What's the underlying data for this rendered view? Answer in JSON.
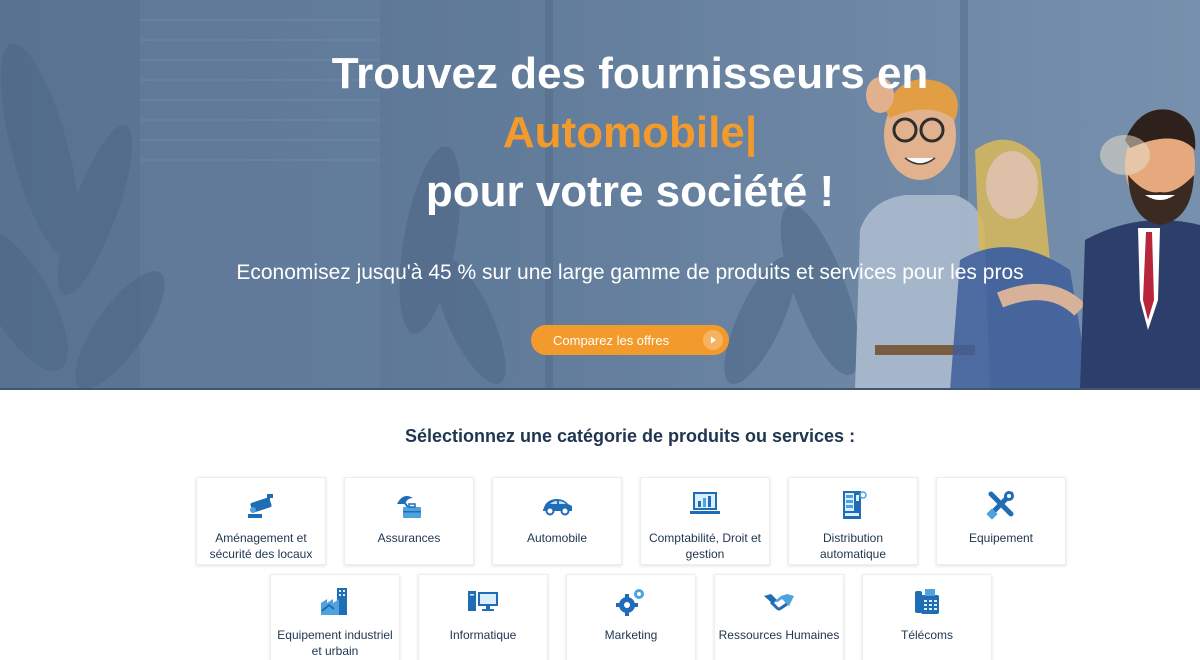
{
  "hero": {
    "title_line1": "Trouvez des fournisseurs en",
    "title_highlight": "Automobile",
    "caret": "|",
    "title_line3": "pour votre société !",
    "subtitle": "Economisez jusqu'à 45 % sur une large gamme de produits et services pour les pros",
    "cta_label": "Comparez les offres",
    "accent_color": "#f39a2c"
  },
  "categories": {
    "title": "Sélectionnez une catégorie de produits ou services :",
    "items": [
      {
        "label": "Aménagement et sécurité des locaux",
        "icon": "security-camera-icon"
      },
      {
        "label": "Assurances",
        "icon": "umbrella-briefcase-icon"
      },
      {
        "label": "Automobile",
        "icon": "car-icon"
      },
      {
        "label": "Comptabilité, Droit et gestion",
        "icon": "laptop-chart-icon"
      },
      {
        "label": "Distribution automatique",
        "icon": "vending-machine-icon"
      },
      {
        "label": "Equipement",
        "icon": "tools-icon"
      },
      {
        "label": "Equipement industriel et urbain",
        "icon": "factory-icon"
      },
      {
        "label": "Informatique",
        "icon": "computer-icon"
      },
      {
        "label": "Marketing",
        "icon": "gears-icon"
      },
      {
        "label": "Ressources Humaines",
        "icon": "handshake-icon"
      },
      {
        "label": "Télécoms",
        "icon": "fax-phone-icon"
      }
    ],
    "icon_color": "#1f6db4"
  }
}
